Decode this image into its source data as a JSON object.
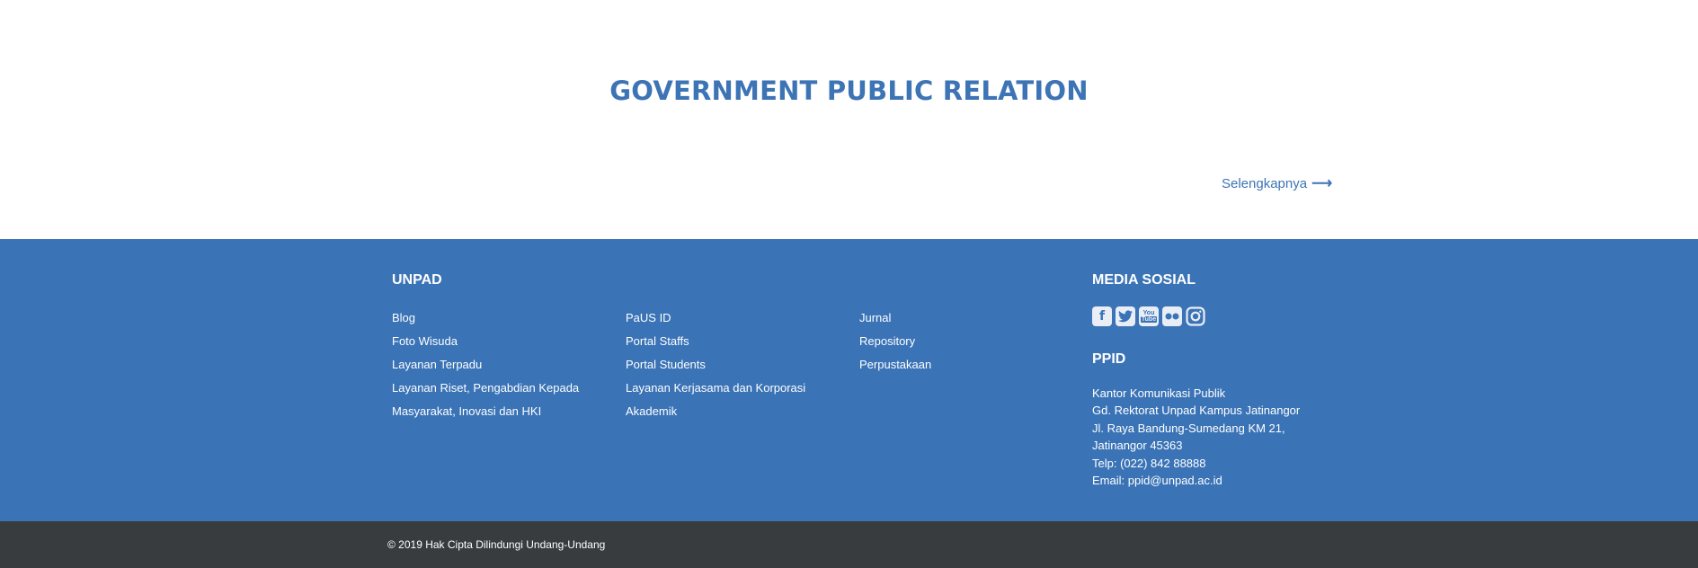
{
  "hero": {
    "title": "GOVERNMENT PUBLIC RELATION",
    "more_link": "Selengkapnya",
    "arrow": "⟶"
  },
  "footer": {
    "unpad": {
      "heading": "UNPAD",
      "col1": [
        "Blog",
        "Foto Wisuda",
        "Layanan Terpadu",
        "Layanan Riset, Pengabdian Kepada",
        "Masyarakat, Inovasi dan HKI"
      ],
      "col2": [
        "PaUS ID",
        "Portal Staffs",
        "Portal Students",
        "Layanan Kerjasama dan Korporasi",
        "Akademik"
      ],
      "col3": [
        "Jurnal",
        "Repository",
        "Perpustakaan"
      ]
    },
    "media": {
      "heading": "MEDIA SOSIAL",
      "icons": [
        {
          "name": "facebook-icon",
          "glyph": "f"
        },
        {
          "name": "twitter-icon",
          "glyph": "t"
        },
        {
          "name": "youtube-icon",
          "glyph": "You Tube"
        },
        {
          "name": "flickr-icon",
          "glyph": "••"
        },
        {
          "name": "instagram-icon",
          "glyph": "◎"
        }
      ]
    },
    "ppid": {
      "heading": "PPID",
      "lines": [
        "Kantor Komunikasi Publik",
        "Gd. Rektorat Unpad Kampus Jatinangor",
        "Jl. Raya Bandung-Sumedang KM 21,",
        "Jatinangor 45363",
        "Telp: (022) 842 88888",
        "Email: ppid@unpad.ac.id"
      ]
    }
  },
  "bottom": {
    "copyright": "© 2019 Hak Cipta Dilindungi Undang-Undang"
  },
  "colors": {
    "primary": "#3a73b6",
    "title": "#3d74b5",
    "bottom_bar": "#393c3f"
  }
}
